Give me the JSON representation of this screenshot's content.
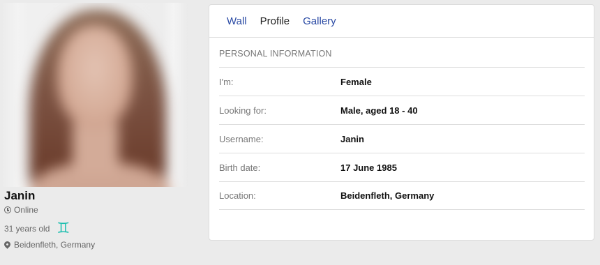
{
  "profile": {
    "name": "Janin",
    "status": "Online",
    "age_text": "31 years old",
    "zodiac_symbol": "♊",
    "location": "Beidenfleth, Germany"
  },
  "tabs": [
    {
      "label": "Wall",
      "active": false
    },
    {
      "label": "Profile",
      "active": true
    },
    {
      "label": "Gallery",
      "active": false
    }
  ],
  "personal_info": {
    "heading": "PERSONAL INFORMATION",
    "rows": [
      {
        "label": "I'm:",
        "value": "Female"
      },
      {
        "label": "Looking for:",
        "value": "Male, aged 18 - 40"
      },
      {
        "label": "Username:",
        "value": "Janin"
      },
      {
        "label": "Birth date:",
        "value": "17 June 1985"
      },
      {
        "label": "Location:",
        "value": "Beidenfleth, Germany"
      }
    ]
  },
  "colors": {
    "link": "#2a4aa4",
    "zodiac": "#1fbfb0",
    "background": "#ebebeb"
  }
}
